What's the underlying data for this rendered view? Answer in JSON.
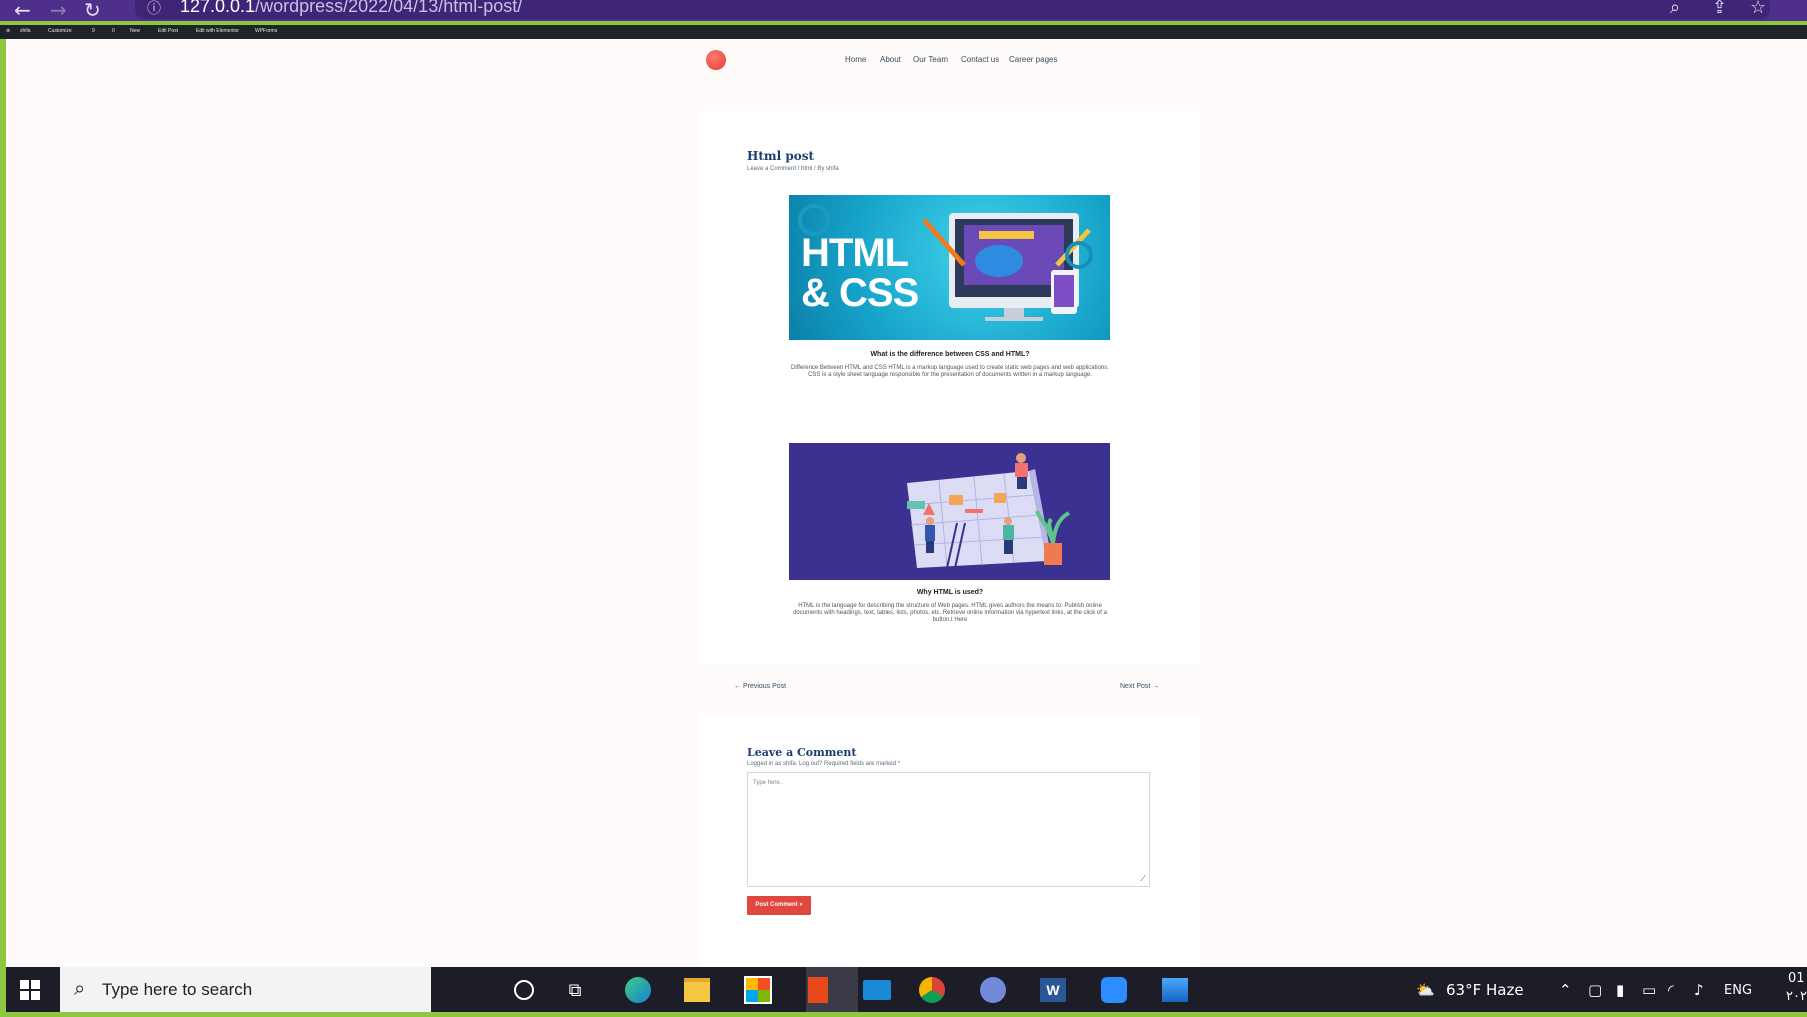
{
  "browser": {
    "url_host": "127.0.0.1",
    "url_path": "/wordpress/2022/04/13/html-post/"
  },
  "admin_bar": {
    "items": [
      "shifa",
      "Customize",
      "9",
      "0",
      "New",
      "Edit Post",
      "Edit with Elementor",
      "WPForms"
    ]
  },
  "site": {
    "nav": [
      "Home",
      "About",
      "Our Team",
      "Contact us",
      "Career pages"
    ]
  },
  "post": {
    "title": "Html post",
    "meta": "Leave a Comment / html / By shifa",
    "image1_text_line1": "HTML",
    "image1_text_line2": "& CSS",
    "section1_heading": "What is the difference between CSS and HTML?",
    "section1_line1": "Difference Between HTML and CSS HTML is a markup language used to create static web pages and web applications.",
    "section1_line2": "CSS is a style sheet language responsible for the presentation of documents written in a markup language.",
    "section2_heading": "Why HTML is used?",
    "section2_line1": "HTML is the language for describing the structure of Web pages. HTML gives authors the means to: Publish online",
    "section2_line2": "documents with headings, text, tables, lists, photos, etc. Retrieve online information via hypertext links, at the click of a",
    "section2_line3": "button.t Here"
  },
  "post_nav": {
    "previous": "← Previous Post",
    "next": "Next Post →"
  },
  "comments": {
    "title": "Leave a Comment",
    "logged_in": "Logged in as shifa. Log out? Required fields are marked *",
    "placeholder": "Type here..",
    "submit": "Post Comment »"
  },
  "taskbar": {
    "search_placeholder": "Type here to search",
    "weather": "63°F  Haze",
    "language": "ENG",
    "clock": "01",
    "date": "٢٠٢"
  },
  "colors": {
    "browser_chrome": "#4e2f8c",
    "accent_red": "#e0483e",
    "title_blue": "#1c3d6e"
  }
}
